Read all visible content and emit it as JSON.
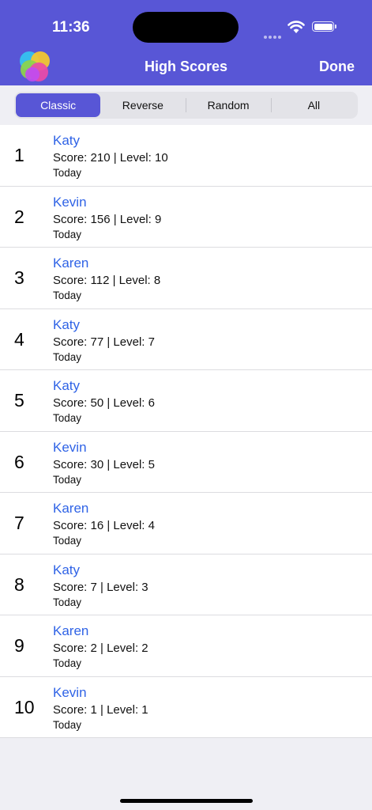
{
  "status_bar": {
    "time": "11:36"
  },
  "nav": {
    "title": "High Scores",
    "done_label": "Done"
  },
  "segments": [
    "Classic",
    "Reverse",
    "Random",
    "All"
  ],
  "selected_segment": "Classic",
  "scores": [
    {
      "rank": "1",
      "name": "Katy",
      "detail": "Score: 210 | Level: 10",
      "date": "Today"
    },
    {
      "rank": "2",
      "name": "Kevin",
      "detail": "Score: 156 | Level: 9",
      "date": "Today"
    },
    {
      "rank": "3",
      "name": "Karen",
      "detail": "Score: 112 | Level: 8",
      "date": "Today"
    },
    {
      "rank": "4",
      "name": "Katy",
      "detail": "Score: 77 | Level: 7",
      "date": "Today"
    },
    {
      "rank": "5",
      "name": "Katy",
      "detail": "Score: 50 | Level: 6",
      "date": "Today"
    },
    {
      "rank": "6",
      "name": "Kevin",
      "detail": "Score: 30 | Level: 5",
      "date": "Today"
    },
    {
      "rank": "7",
      "name": "Karen",
      "detail": "Score: 16 | Level: 4",
      "date": "Today"
    },
    {
      "rank": "8",
      "name": "Katy",
      "detail": "Score: 7 | Level: 3",
      "date": "Today"
    },
    {
      "rank": "9",
      "name": "Karen",
      "detail": "Score: 2 | Level: 2",
      "date": "Today"
    },
    {
      "rank": "10",
      "name": "Kevin",
      "detail": "Score: 1 | Level: 1",
      "date": "Today"
    }
  ],
  "colors": {
    "accent": "#5856d6",
    "name_link": "#2f63e6",
    "background": "#efeff4"
  },
  "icons": [
    "wifi-icon",
    "battery-icon",
    "app-logo-icon"
  ]
}
